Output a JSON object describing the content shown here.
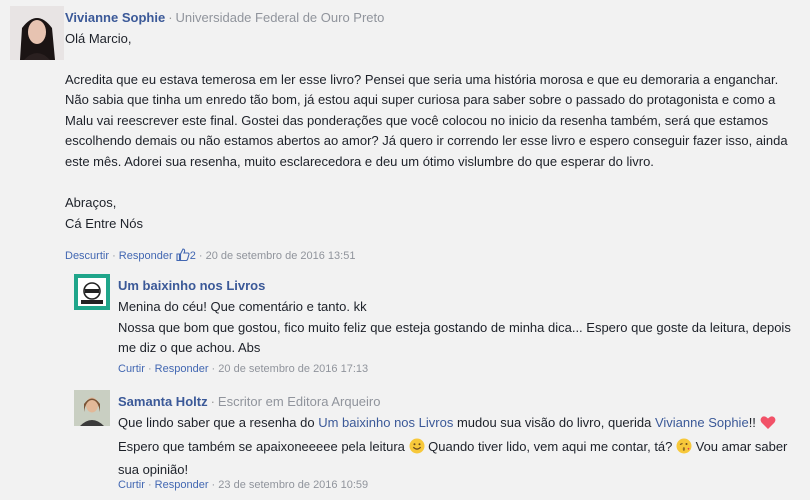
{
  "c1": {
    "author": "Vivianne Sophie",
    "affiliation": "Universidade Federal de Ouro Preto",
    "greeting": "Olá Marcio,",
    "body": "Acredita que eu estava temerosa em ler esse livro? Pensei que seria uma história morosa e que eu demoraria a enganchar. Não sabia que tinha um enredo tão bom, já estou aqui super curiosa para saber sobre o passado do protagonista e como a Malu vai reescrever este final. Gostei das ponderações que você colocou no inicio da resenha também, será que estamos escolhendo demais ou não estamos abertos ao amor? Já quero ir correndo ler esse livro e espero conseguir fazer isso, ainda este mês. Adorei sua resenha, muito esclarecedora e deu um ótimo vislumbre do que esperar do livro.",
    "signoff1": "Abraços,",
    "signoff2": "Cá Entre Nós",
    "unlike": "Descurtir",
    "reply": "Responder",
    "likes": "2",
    "date": "20 de setembro de 2016 13:51"
  },
  "c2": {
    "author": "Um baixinho nos Livros",
    "line1": "Menina do céu! Que comentário e tanto. kk",
    "line2": "Nossa que bom que gostou, fico muito feliz que esteja gostando de minha dica... Espero que goste da leitura, depois me diz o que achou. Abs",
    "like": "Curtir",
    "reply": "Responder",
    "date": "20 de setembro de 2016 17:13"
  },
  "c3": {
    "author": "Samanta Holtz",
    "affiliation": "Escritor em Editora Arqueiro",
    "t1": "Que lindo saber que a resenha do ",
    "mention1": "Um baixinho nos Livros",
    "t2": " mudou sua visão do livro, querida ",
    "mention2": "Vivianne Sophie",
    "t3": "!! ",
    "t4": " Espero que também se apaixoneeeee pela leitura ",
    "t5": " Quando tiver lido, vem aqui me contar, tá? ",
    "t6": " Vou amar saber sua opinião!",
    "like": "Curtir",
    "reply": "Responder",
    "date": "23 de setembro de 2016 10:59"
  },
  "colors": {
    "author": "#3b5998",
    "link": "#4267b2",
    "meta": "#90949c",
    "background": "#f2f2f2"
  },
  "icons": [
    "thumbs-up-icon",
    "heart-emoji-icon",
    "smile-emoji-icon",
    "kiss-emoji-icon"
  ]
}
